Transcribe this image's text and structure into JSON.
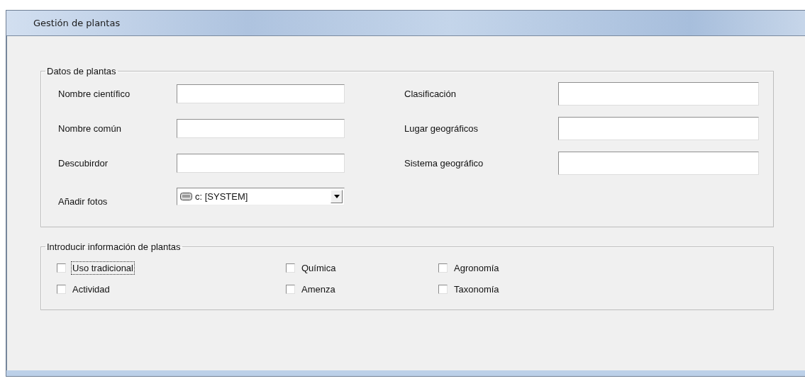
{
  "window": {
    "title": "Gestión de plantas"
  },
  "plant_data": {
    "title": "Datos de plantas",
    "fields": [
      {
        "label": "Nombre científico"
      },
      {
        "label": "Clasificación"
      },
      {
        "label": "Nombre común"
      },
      {
        "label": "Lugar geográficos"
      },
      {
        "label": "Descubirdor"
      },
      {
        "label": "Sistema geográfico"
      }
    ],
    "photo": {
      "label": "Añadir fotos",
      "value": "c: [SYSTEM]"
    }
  },
  "info": {
    "title": "Introducir información de plantas",
    "options": [
      {
        "label": "Uso tradicional",
        "checked": false,
        "focused": true
      },
      {
        "label": "Química",
        "checked": false,
        "focused": false
      },
      {
        "label": "Agronomía",
        "checked": false,
        "focused": false
      },
      {
        "label": "Actividad",
        "checked": false,
        "focused": false
      },
      {
        "label": "Amenza",
        "checked": false,
        "focused": false
      },
      {
        "label": "Taxonomía",
        "checked": false,
        "focused": false
      }
    ]
  }
}
